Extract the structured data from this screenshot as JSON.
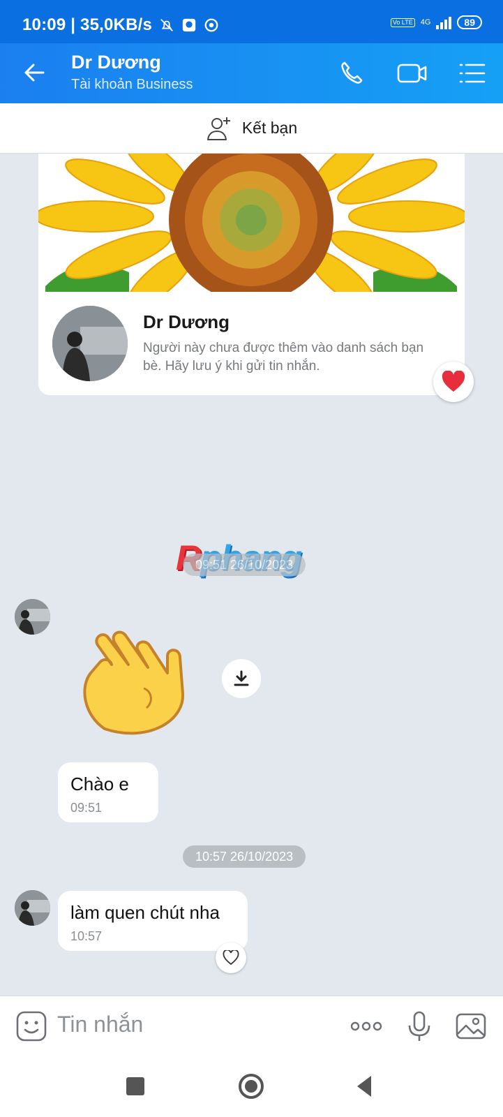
{
  "status_bar": {
    "time_speed": "10:09 | 35,0KB/s",
    "volte": "Vo LTE",
    "network": "4G",
    "battery": "89"
  },
  "header": {
    "title": "Dr Dương",
    "subtitle": "Tài khoản Business",
    "icons": [
      "back-arrow-icon",
      "phone-icon",
      "video-call-icon",
      "menu-list-icon"
    ]
  },
  "friend_bar": {
    "label": "Kết bạn",
    "icon": "add-friend-icon"
  },
  "profile_card": {
    "name": "Dr Dương",
    "note": "Người này chưa được thêm vào danh sách bạn bè. Hãy lưu ý khi gửi tin nhắn."
  },
  "watermark": {
    "first": "R",
    "rest": "phang"
  },
  "conversation": {
    "timestamp_1": "09:51 26/10/2023",
    "sticker": "waving-hand-sticker",
    "message_1": {
      "text": "Chào e",
      "time": "09:51"
    },
    "timestamp_2": "10:57 26/10/2023",
    "message_2": {
      "text": "làm quen chút nha",
      "time": "10:57"
    }
  },
  "input_bar": {
    "placeholder": "Tin nhắn",
    "icons": [
      "emoji-icon",
      "more-dots-icon",
      "microphone-icon",
      "image-icon"
    ]
  },
  "nav_bar": {
    "icons": [
      "recent-apps-icon",
      "home-icon",
      "back-icon"
    ]
  },
  "colors": {
    "header_start": "#1b7ff0",
    "header_end": "#15a0f5",
    "chat_background": "#e2e8ed",
    "timestamp_pill": "#b9bec3",
    "heart": "#e62e3d"
  }
}
